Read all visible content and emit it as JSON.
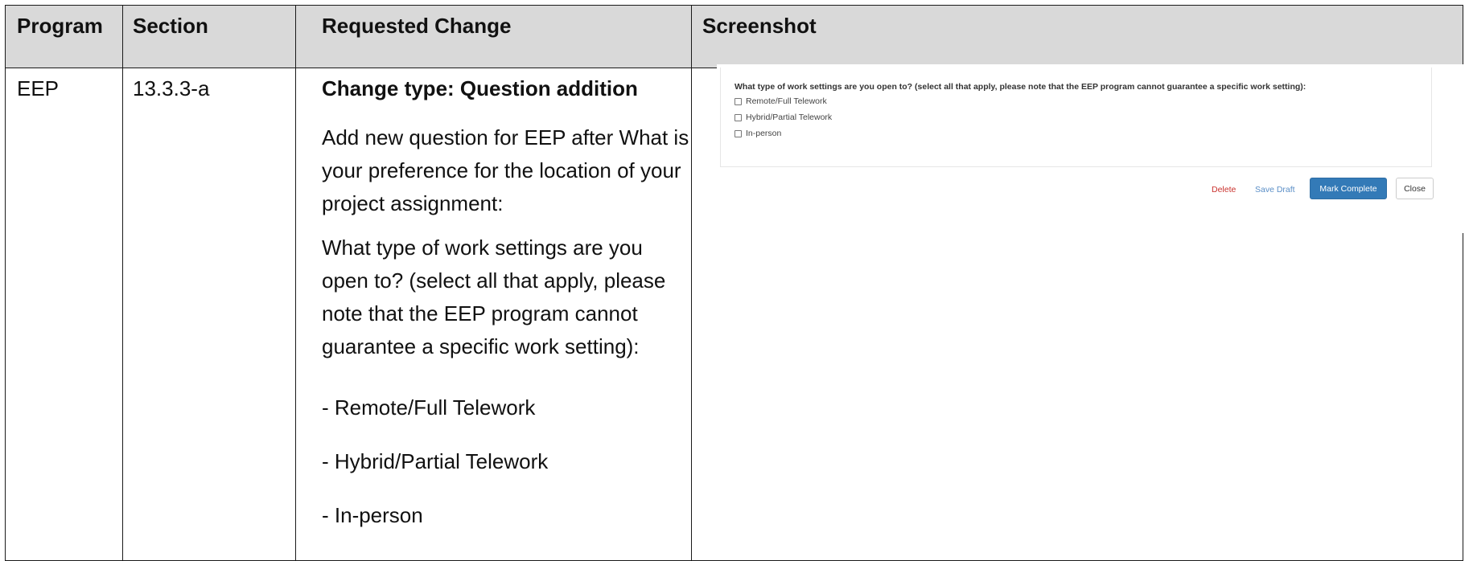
{
  "table": {
    "headers": {
      "program": "Program",
      "section": "Section",
      "requested_change": "Requested Change",
      "screenshot": "Screenshot"
    },
    "row": {
      "program": "EEP",
      "section": "13.3.3-a",
      "change_type": "Change type: Question addition",
      "paragraphs": [
        "Add new question for EEP after What is your preference for the location of your project assignment:",
        "What type of work settings are you open to? (select all that apply, please note that the EEP program cannot guarantee a specific work setting):",
        "- Remote/Full Telework",
        "- Hybrid/Partial Telework",
        "- In-person"
      ]
    }
  },
  "screenshot": {
    "question_prefix": "What type of work settings are you open to? (select all that apply, please note that the ",
    "question_bold": "EEP",
    "question_suffix": " program cannot guarantee a specific work setting):",
    "options": [
      "Remote/Full Telework",
      "Hybrid/Partial Telework",
      "In-person"
    ],
    "buttons": {
      "delete": "Delete",
      "save_draft": "Save Draft",
      "mark_complete": "Mark Complete",
      "close": "Close"
    },
    "colors": {
      "delete": "#c9302c",
      "save_draft": "#5b8fc7",
      "primary": "#337ab7"
    }
  }
}
